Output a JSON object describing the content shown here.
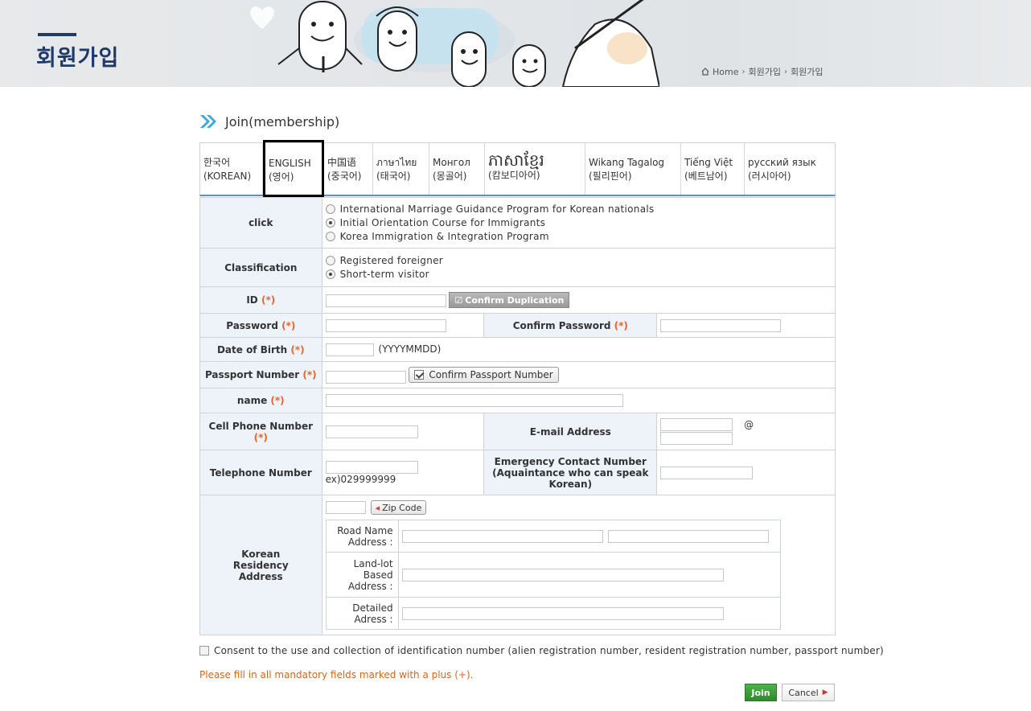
{
  "header": {
    "title": "회원가입",
    "breadcrumb": [
      "Home",
      "회원가입",
      "회원가입"
    ]
  },
  "section": {
    "title": "Join(membership)"
  },
  "languages": [
    {
      "line1": "한국어",
      "line2": "(KOREAN)"
    },
    {
      "line1": "ENGLISH",
      "line2": "(영어)"
    },
    {
      "line1": "中国语",
      "line2": "(중국어)"
    },
    {
      "line1": "ภาษาไทย",
      "line2": "(태국어)"
    },
    {
      "line1": "Монгол",
      "line2": "(몽골어)"
    },
    {
      "line1": "ភាសាខ្មែរ",
      "line2": "(캄보디아어)"
    },
    {
      "line1": "Wikang Tagalog",
      "line2": "(필리핀어)"
    },
    {
      "line1": "Tiếng Việt",
      "line2": "(베트남어)"
    },
    {
      "line1": "русский язык",
      "line2": "(러시아어)"
    }
  ],
  "form": {
    "click_label": "click",
    "programs": [
      "International Marriage Guidance Program for Korean nationals",
      "Initial Orientation Course for Immigrants",
      "Korea Immigration & Integration Program"
    ],
    "classification_label": "Classification",
    "classifications": [
      "Registered foreigner",
      "Short-term visitor"
    ],
    "required_mark": "(*)",
    "id_label": "ID",
    "confirm_duplication": "Confirm Duplication",
    "password_label": "Password",
    "confirm_password_label": "Confirm Password",
    "dob_label": "Date of Birth",
    "dob_hint": "(YYYYMMDD)",
    "passport_label": "Passport Number",
    "confirm_passport": "Confirm Passport Number",
    "name_label": "name",
    "cell_label": "Cell Phone Number",
    "email_label": "E-mail Address",
    "at_sign": "@",
    "tel_label": "Telephone Number",
    "tel_hint": "ex)029999999",
    "emergency_label": "Emergency Contact Number (Aquaintance who can speak Korean)",
    "address_label": "Korean Residency Address",
    "zip_code": "Zip Code",
    "road_label": "Road Name Address :",
    "landlot_label": "Land-lot Based Address :",
    "detailed_label": "Detailed Adress :"
  },
  "consent": "Consent to the use and collection of identification number (alien registration number, resident registration number, passport number)",
  "notice": "Please fill in all mandatory fields marked with a plus (+).",
  "buttons": {
    "join": "Join",
    "cancel": "Cancel"
  },
  "colors": {
    "accent": "#1d3a6b",
    "label_bg": "#eef3fa",
    "required": "#e8662a",
    "join": "#3a9e38"
  }
}
